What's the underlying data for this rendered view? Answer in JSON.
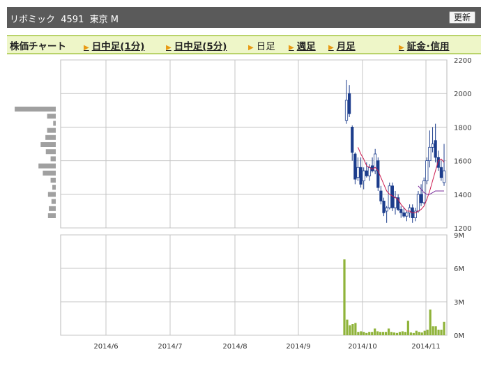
{
  "header": {
    "title": "リボミック  4591  東京 M",
    "refresh_label": "更新"
  },
  "tabs": {
    "chart_label": "株価チャート",
    "items": [
      {
        "label": "日中足(1分)",
        "link": true
      },
      {
        "label": "日中足(5分)",
        "link": true
      },
      {
        "label": "日足",
        "link": false
      },
      {
        "label": "週足",
        "link": true
      },
      {
        "label": "月足",
        "link": true
      },
      {
        "label": "証金･信用",
        "link": true
      }
    ]
  },
  "colors": {
    "up": "#ffffff",
    "down": "#1c3d8c",
    "ma_short": "#cc1a4f",
    "ma_long": "#7a2a9a",
    "volume": "#8fb33a",
    "profile": "#a0a0a0"
  },
  "chart_data": {
    "type": "candlestick",
    "price_axis": {
      "ylim": [
        1200,
        2200
      ],
      "ticks": [
        "1200",
        "1400",
        "1600",
        "1800",
        "2000",
        "2200"
      ]
    },
    "volume_axis": {
      "ylim": [
        0,
        9
      ],
      "ticks": [
        "0M",
        "3M",
        "6M",
        "9M"
      ]
    },
    "x_tick_labels": [
      "2014/6",
      "2014/7",
      "2014/8",
      "2014/9",
      "2014/10",
      "2014/11"
    ],
    "price_volume_profile": [
      0.95,
      0.2,
      0.06,
      0.2,
      0.24,
      0.35,
      0.23,
      0.12,
      0.4,
      0.3,
      0.12,
      0.08,
      0.18,
      0.1,
      0.16,
      0.18
    ],
    "candles": [
      {
        "o": 1840,
        "h": 2080,
        "l": 1820,
        "c": 1960
      },
      {
        "o": 2000,
        "h": 2050,
        "l": 1860,
        "c": 1880
      },
      {
        "o": 1800,
        "h": 1810,
        "l": 1600,
        "c": 1650
      },
      {
        "o": 1640,
        "h": 1650,
        "l": 1460,
        "c": 1490
      },
      {
        "o": 1500,
        "h": 1620,
        "l": 1480,
        "c": 1560
      },
      {
        "o": 1560,
        "h": 1620,
        "l": 1440,
        "c": 1460
      },
      {
        "o": 1480,
        "h": 1560,
        "l": 1430,
        "c": 1540
      },
      {
        "o": 1540,
        "h": 1590,
        "l": 1500,
        "c": 1510
      },
      {
        "o": 1510,
        "h": 1580,
        "l": 1480,
        "c": 1560
      },
      {
        "o": 1570,
        "h": 1620,
        "l": 1530,
        "c": 1540
      },
      {
        "o": 1540,
        "h": 1670,
        "l": 1520,
        "c": 1640
      },
      {
        "o": 1600,
        "h": 1620,
        "l": 1420,
        "c": 1440
      },
      {
        "o": 1420,
        "h": 1450,
        "l": 1340,
        "c": 1360
      },
      {
        "o": 1360,
        "h": 1380,
        "l": 1270,
        "c": 1290
      },
      {
        "o": 1300,
        "h": 1330,
        "l": 1230,
        "c": 1320
      },
      {
        "o": 1320,
        "h": 1470,
        "l": 1310,
        "c": 1450
      },
      {
        "o": 1450,
        "h": 1470,
        "l": 1300,
        "c": 1320
      },
      {
        "o": 1320,
        "h": 1420,
        "l": 1280,
        "c": 1380
      },
      {
        "o": 1380,
        "h": 1400,
        "l": 1300,
        "c": 1310
      },
      {
        "o": 1310,
        "h": 1330,
        "l": 1260,
        "c": 1290
      },
      {
        "o": 1290,
        "h": 1320,
        "l": 1260,
        "c": 1270
      },
      {
        "o": 1270,
        "h": 1300,
        "l": 1240,
        "c": 1290
      },
      {
        "o": 1290,
        "h": 1340,
        "l": 1260,
        "c": 1320
      },
      {
        "o": 1320,
        "h": 1340,
        "l": 1230,
        "c": 1260
      },
      {
        "o": 1260,
        "h": 1320,
        "l": 1240,
        "c": 1300
      },
      {
        "o": 1300,
        "h": 1420,
        "l": 1290,
        "c": 1400
      },
      {
        "o": 1400,
        "h": 1460,
        "l": 1330,
        "c": 1350
      },
      {
        "o": 1350,
        "h": 1500,
        "l": 1340,
        "c": 1480
      },
      {
        "o": 1480,
        "h": 1620,
        "l": 1460,
        "c": 1600
      },
      {
        "o": 1600,
        "h": 1780,
        "l": 1560,
        "c": 1680
      },
      {
        "o": 1680,
        "h": 1800,
        "l": 1650,
        "c": 1700
      },
      {
        "o": 1720,
        "h": 1820,
        "l": 1590,
        "c": 1620
      },
      {
        "o": 1620,
        "h": 1660,
        "l": 1540,
        "c": 1560
      },
      {
        "o": 1560,
        "h": 1600,
        "l": 1480,
        "c": 1500
      },
      {
        "o": 1470,
        "h": 1700,
        "l": 1450,
        "c": 1540
      }
    ],
    "ma_short": [
      null,
      null,
      null,
      null,
      1680,
      1640,
      1610,
      1570,
      1560,
      1550,
      1560,
      1540,
      1500,
      1460,
      1420,
      1400,
      1390,
      1380,
      1370,
      1340,
      1320,
      1300,
      1300,
      1290,
      1290,
      1300,
      1310,
      1330,
      1370,
      1420,
      1480,
      1540,
      1600,
      1610,
      1590
    ],
    "ma_long": [
      null,
      null,
      null,
      null,
      null,
      null,
      null,
      null,
      null,
      null,
      null,
      null,
      null,
      null,
      null,
      null,
      null,
      null,
      null,
      null,
      null,
      null,
      null,
      null,
      null,
      1450,
      1430,
      1410,
      1400,
      1400,
      1410,
      1420,
      1420,
      1420,
      1420
    ],
    "volumes": [
      6.8,
      1.4,
      0.9,
      1.0,
      1.1,
      0.3,
      0.35,
      0.3,
      0.2,
      0.3,
      0.3,
      0.6,
      0.35,
      0.3,
      0.3,
      0.3,
      0.6,
      0.3,
      0.25,
      0.2,
      0.3,
      0.35,
      0.3,
      1.3,
      0.25,
      0.2,
      0.4,
      0.3,
      0.25,
      0.4,
      0.5,
      2.3,
      0.8,
      0.8,
      0.5,
      0.5,
      1.2
    ]
  }
}
